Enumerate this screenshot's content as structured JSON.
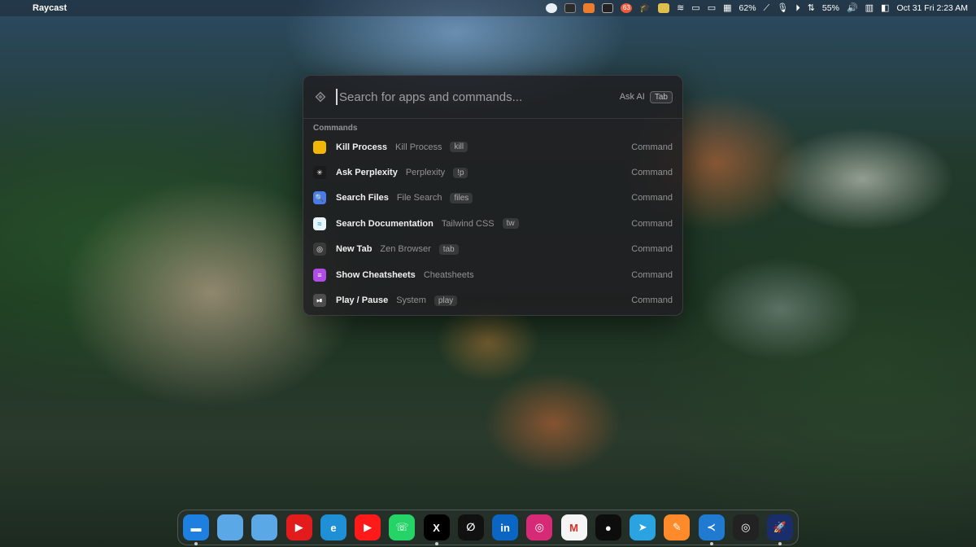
{
  "menubar": {
    "app_name": "Raycast",
    "battery_pct_1": "62%",
    "battery_pct_2": "55%",
    "datetime": "Oct 31 Fri 2:23 AM",
    "tray_badge": "63"
  },
  "search": {
    "placeholder": "Search for apps and commands...",
    "ask_ai": "Ask AI",
    "tab_key": "Tab"
  },
  "section_title": "Commands",
  "commands": [
    {
      "title": "Kill Process",
      "subtitle": "Kill Process",
      "alias": "kill",
      "kind": "Command",
      "icon": "kill-process-icon",
      "color": "#f2b705",
      "glyph": ""
    },
    {
      "title": "Ask Perplexity",
      "subtitle": "Perplexity",
      "alias": "!p",
      "kind": "Command",
      "icon": "perplexity-icon",
      "color": "#1b1b1b",
      "glyph": "✳"
    },
    {
      "title": "Search Files",
      "subtitle": "File Search",
      "alias": "files",
      "kind": "Command",
      "icon": "file-search-icon",
      "color": "#4a7be8",
      "glyph": "🔍"
    },
    {
      "title": "Search Documentation",
      "subtitle": "Tailwind CSS",
      "alias": "tw",
      "kind": "Command",
      "icon": "tailwind-icon",
      "color": "#e9f4fb",
      "glyph": "≈"
    },
    {
      "title": "New Tab",
      "subtitle": "Zen Browser",
      "alias": "tab",
      "kind": "Command",
      "icon": "zen-browser-icon",
      "color": "#3a3a3a",
      "glyph": "◎"
    },
    {
      "title": "Show Cheatsheets",
      "subtitle": "Cheatsheets",
      "alias": "",
      "kind": "Command",
      "icon": "cheatsheets-icon",
      "color": "#b14de6",
      "glyph": "≡"
    },
    {
      "title": "Play / Pause",
      "subtitle": "System",
      "alias": "play",
      "kind": "Command",
      "icon": "play-pause-icon",
      "color": "#4d4d4d",
      "glyph": "⏯"
    }
  ],
  "dock": [
    {
      "name": "finder-icon",
      "color": "#1d7fe0",
      "glyph": "▬",
      "running": true
    },
    {
      "name": "folder-icon",
      "color": "#5aa8e6",
      "glyph": "",
      "running": false
    },
    {
      "name": "folder-icon",
      "color": "#5aa8e6",
      "glyph": "",
      "running": false
    },
    {
      "name": "youtube-music-icon",
      "color": "#e21c1c",
      "glyph": "▶",
      "running": false
    },
    {
      "name": "edge-icon",
      "color": "#1f8fd6",
      "glyph": "e",
      "running": false
    },
    {
      "name": "youtube-icon",
      "color": "#ff1a1a",
      "glyph": "▶",
      "running": false
    },
    {
      "name": "whatsapp-icon",
      "color": "#25d366",
      "glyph": "☏",
      "running": false
    },
    {
      "name": "x-icon",
      "color": "#000000",
      "glyph": "X",
      "running": true
    },
    {
      "name": "zen-icon",
      "color": "#111111",
      "glyph": "∅",
      "running": false
    },
    {
      "name": "linkedin-icon",
      "color": "#0a66c2",
      "glyph": "in",
      "running": false
    },
    {
      "name": "instagram-icon",
      "color": "#d62976",
      "glyph": "◎",
      "running": false
    },
    {
      "name": "gmail-icon",
      "color": "#f5f5f5",
      "glyph": "M",
      "running": false
    },
    {
      "name": "github-icon",
      "color": "#0d0d0d",
      "glyph": "●",
      "running": false
    },
    {
      "name": "telegram-icon",
      "color": "#2aa3e0",
      "glyph": "➤",
      "running": false
    },
    {
      "name": "pages-icon",
      "color": "#ff8a2a",
      "glyph": "✎",
      "running": false
    },
    {
      "name": "vscode-icon",
      "color": "#1f7ad0",
      "glyph": "≺",
      "running": true
    },
    {
      "name": "zen-browser-icon",
      "color": "#222222",
      "glyph": "◎",
      "running": false
    },
    {
      "name": "raycast-rocket-icon",
      "color": "#1a2e6b",
      "glyph": "🚀",
      "running": true
    }
  ]
}
